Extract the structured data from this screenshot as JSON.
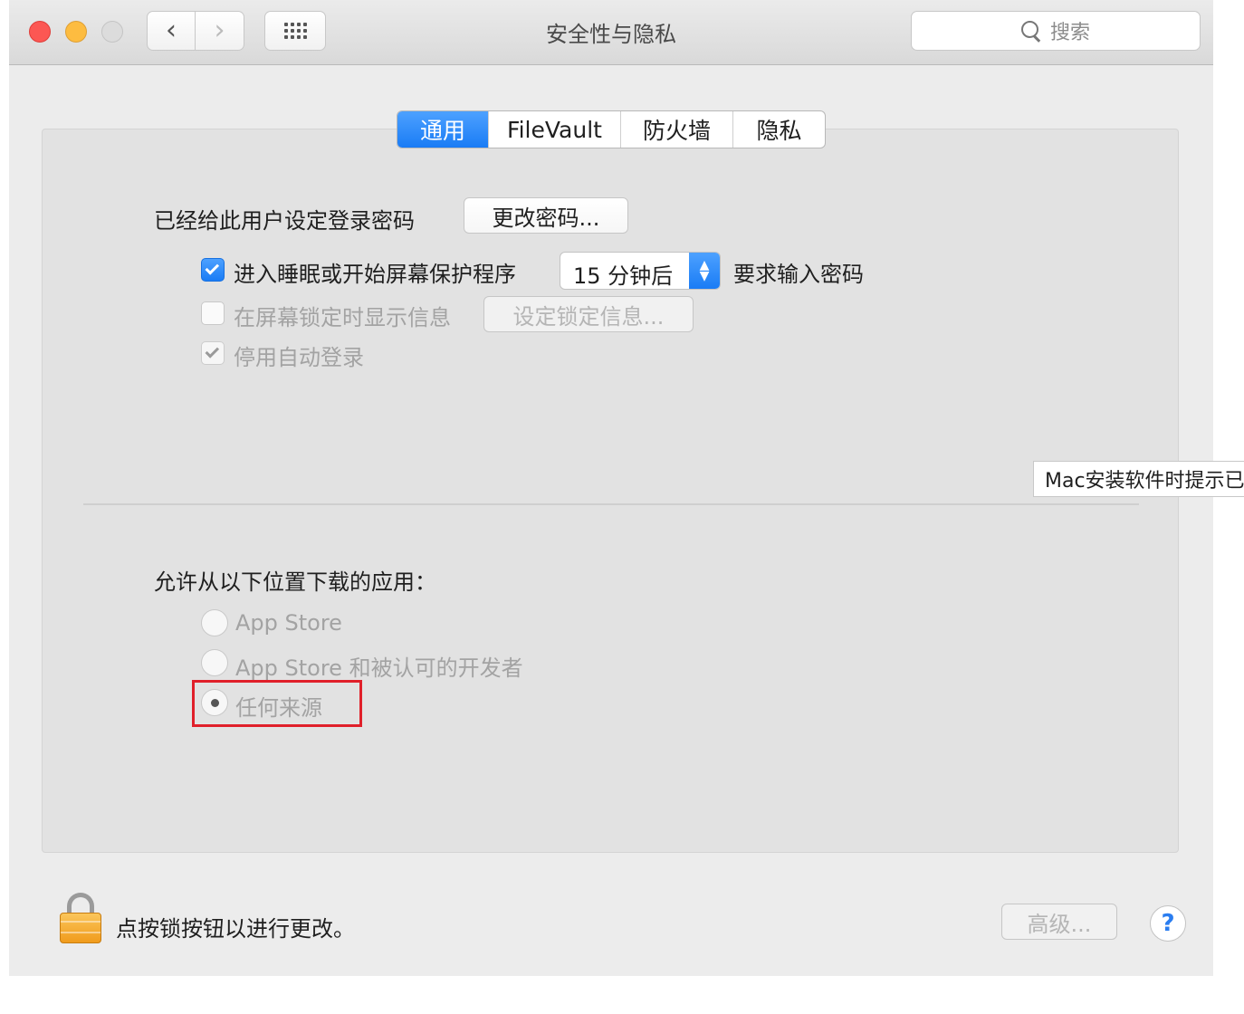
{
  "window": {
    "title": "安全性与隐私",
    "search_placeholder": "搜索"
  },
  "tabs": [
    {
      "label": "通用",
      "active": true
    },
    {
      "label": "FileVault",
      "active": false
    },
    {
      "label": "防火墙",
      "active": false
    },
    {
      "label": "隐私",
      "active": false
    }
  ],
  "general": {
    "password_set_label": "已经给此用户设定登录密码",
    "change_password_button": "更改密码...",
    "require_password": {
      "label": "进入睡眠或开始屏幕保护程序",
      "checked": true,
      "delay_value": "15 分钟后",
      "suffix": "要求输入密码"
    },
    "lock_message": {
      "label": "在屏幕锁定时显示信息",
      "checked": false,
      "button": "设定锁定信息..."
    },
    "disable_auto_login": {
      "label": "停用自动登录",
      "checked": true
    }
  },
  "downloads": {
    "heading": "允许从以下位置下载的应用：",
    "options": [
      {
        "label": "App Store",
        "selected": false
      },
      {
        "label": "App Store 和被认可的开发者",
        "selected": false
      },
      {
        "label": "任何来源",
        "selected": true
      }
    ]
  },
  "tooltip": {
    "text": "Mac安装软件时提示已"
  },
  "footer": {
    "lock_text": "点按锁按钮以进行更改。",
    "advanced_button": "高级...",
    "help_label": "?"
  },
  "colors": {
    "accent": "#1a7cf5",
    "highlight": "#e0202a",
    "lock": "#f09b1c"
  }
}
